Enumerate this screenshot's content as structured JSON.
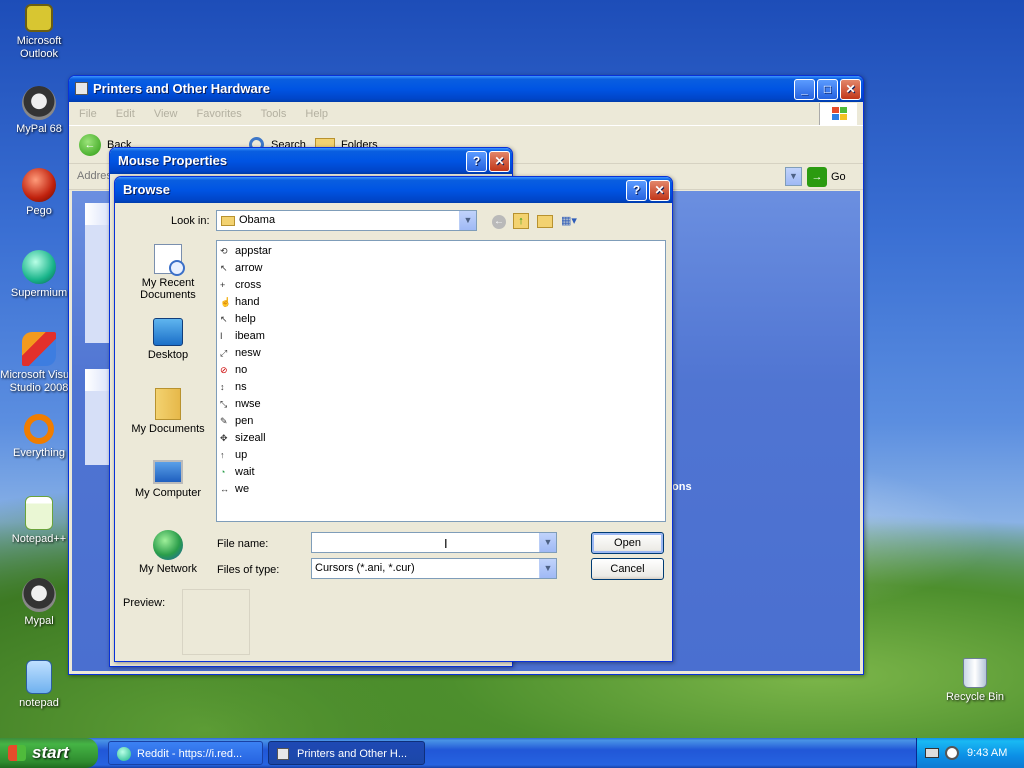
{
  "desktop": {
    "icons": [
      {
        "label": "Microsoft Outlook"
      },
      {
        "label": "MyPal 68"
      },
      {
        "label": "Pego"
      },
      {
        "label": "Supermium"
      },
      {
        "label": "Microsoft Visual Studio 2008"
      },
      {
        "label": "Everything"
      },
      {
        "label": "Notepad++"
      },
      {
        "label": "Mypal"
      },
      {
        "label": "notepad"
      },
      {
        "label": "Recycle Bin"
      }
    ]
  },
  "explorer": {
    "title": "Printers and Other Hardware",
    "menu": [
      "File",
      "Edit",
      "View",
      "Favorites",
      "Tools",
      "Help"
    ],
    "toolbar": {
      "back": "Back",
      "search": "Search",
      "folders": "Folders"
    },
    "address_label": "Address",
    "go": "Go",
    "side_label": "ons"
  },
  "mouse_props": {
    "title": "Mouse Properties"
  },
  "browse": {
    "title": "Browse",
    "look_in_label": "Look in:",
    "look_in_value": "Obama",
    "places": [
      "My Recent Documents",
      "Desktop",
      "My Documents",
      "My Computer",
      "My Network"
    ],
    "files": [
      "appstar",
      "arrow",
      "cross",
      "hand",
      "help",
      "ibeam",
      "nesw",
      "no",
      "ns",
      "nwse",
      "pen",
      "sizeall",
      "up",
      "wait",
      "we"
    ],
    "file_name_label": "File name:",
    "file_name_value": "",
    "files_of_type_label": "Files of type:",
    "files_of_type_value": "Cursors (*.ani, *.cur)",
    "open": "Open",
    "cancel": "Cancel",
    "preview_label": "Preview:"
  },
  "taskbar": {
    "start": "start",
    "tasks": [
      {
        "label": "Reddit - https://i.red..."
      },
      {
        "label": "Printers and Other H..."
      }
    ],
    "clock": "9:43 AM"
  }
}
